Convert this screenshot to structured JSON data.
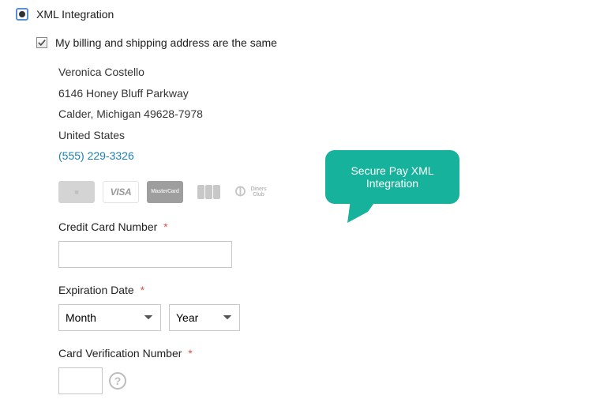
{
  "payment_method": {
    "title": "XML Integration",
    "selected": true
  },
  "same_address": {
    "label": "My billing and shipping address are the same",
    "checked": true
  },
  "address": {
    "name": "Veronica Costello",
    "street": "6146 Honey Bluff Parkway",
    "city_line": "Calder, Michigan 49628-7978",
    "country": "United States",
    "phone": "(555) 229-3326"
  },
  "card_logos": [
    "amex",
    "visa",
    "mastercard",
    "jcb",
    "diners"
  ],
  "cc_number": {
    "label": "Credit Card Number",
    "value": ""
  },
  "exp": {
    "label": "Expiration Date",
    "month_placeholder": "Month",
    "year_placeholder": "Year"
  },
  "cvv": {
    "label": "Card Verification Number",
    "value": ""
  },
  "tooltip": "Secure Pay XML Integration"
}
